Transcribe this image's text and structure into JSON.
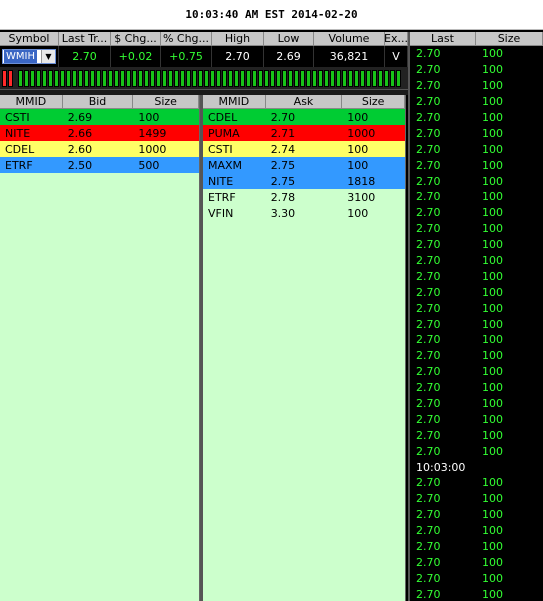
{
  "title": "10:03:40 AM EST 2014-02-20",
  "quote": {
    "headers": [
      "Symbol",
      "Last Tr...",
      "$ Chg...",
      "% Chg...",
      "High",
      "Low",
      "Volume",
      "Ex..."
    ],
    "symbol": "WMIH",
    "last": "2.70",
    "chg": "+0.02",
    "pct_chg": "+0.75",
    "high": "2.70",
    "low": "2.69",
    "volume": "36,821",
    "exchange": "V"
  },
  "tick_bar": {
    "red_count": 2,
    "green_count": 64
  },
  "bid_book": {
    "headers": [
      "MMID",
      "Bid",
      "Size"
    ],
    "rows": [
      {
        "mmid": "CSTI",
        "price": "2.69",
        "size": "100",
        "color": "#00cc33"
      },
      {
        "mmid": "NITE",
        "price": "2.66",
        "size": "1499",
        "color": "#ff0000"
      },
      {
        "mmid": "CDEL",
        "price": "2.60",
        "size": "1000",
        "color": "#ffff66"
      },
      {
        "mmid": "ETRF",
        "price": "2.50",
        "size": "500",
        "color": "#3399ff"
      }
    ]
  },
  "ask_book": {
    "headers": [
      "MMID",
      "Ask",
      "Size"
    ],
    "rows": [
      {
        "mmid": "CDEL",
        "price": "2.70",
        "size": "100",
        "color": "#00cc33"
      },
      {
        "mmid": "PUMA",
        "price": "2.71",
        "size": "1000",
        "color": "#ff0000"
      },
      {
        "mmid": "CSTI",
        "price": "2.74",
        "size": "100",
        "color": "#ffff66"
      },
      {
        "mmid": "MAXM",
        "price": "2.75",
        "size": "100",
        "color": "#3399ff"
      },
      {
        "mmid": "NITE",
        "price": "2.75",
        "size": "1818",
        "color": "#3399ff"
      },
      {
        "mmid": "ETRF",
        "price": "2.78",
        "size": "3100",
        "color": "#ccffcc"
      },
      {
        "mmid": "VFIN",
        "price": "3.30",
        "size": "100",
        "color": "#ccffcc"
      }
    ]
  },
  "time_sales": {
    "headers": [
      "Last",
      "Size"
    ],
    "rows": [
      {
        "price": "2.70",
        "size": "100"
      },
      {
        "price": "2.70",
        "size": "100"
      },
      {
        "price": "2.70",
        "size": "100"
      },
      {
        "price": "2.70",
        "size": "100"
      },
      {
        "price": "2.70",
        "size": "100"
      },
      {
        "price": "2.70",
        "size": "100"
      },
      {
        "price": "2.70",
        "size": "100"
      },
      {
        "price": "2.70",
        "size": "100"
      },
      {
        "price": "2.70",
        "size": "100"
      },
      {
        "price": "2.70",
        "size": "100"
      },
      {
        "price": "2.70",
        "size": "100"
      },
      {
        "price": "2.70",
        "size": "100"
      },
      {
        "price": "2.70",
        "size": "100"
      },
      {
        "price": "2.70",
        "size": "100"
      },
      {
        "price": "2.70",
        "size": "100"
      },
      {
        "price": "2.70",
        "size": "100"
      },
      {
        "price": "2.70",
        "size": "100"
      },
      {
        "price": "2.70",
        "size": "100"
      },
      {
        "price": "2.70",
        "size": "100"
      },
      {
        "price": "2.70",
        "size": "100"
      },
      {
        "price": "2.70",
        "size": "100"
      },
      {
        "price": "2.70",
        "size": "100"
      },
      {
        "price": "2.70",
        "size": "100"
      },
      {
        "price": "2.70",
        "size": "100"
      },
      {
        "price": "2.70",
        "size": "100"
      },
      {
        "price": "2.70",
        "size": "100"
      },
      {
        "price": "10:03:00",
        "size": "",
        "time": true
      },
      {
        "price": "2.70",
        "size": "100"
      },
      {
        "price": "2.70",
        "size": "100"
      },
      {
        "price": "2.70",
        "size": "100"
      },
      {
        "price": "2.70",
        "size": "100"
      },
      {
        "price": "2.70",
        "size": "100"
      },
      {
        "price": "2.70",
        "size": "100"
      },
      {
        "price": "2.70",
        "size": "100"
      },
      {
        "price": "2.70",
        "size": "100"
      }
    ]
  }
}
